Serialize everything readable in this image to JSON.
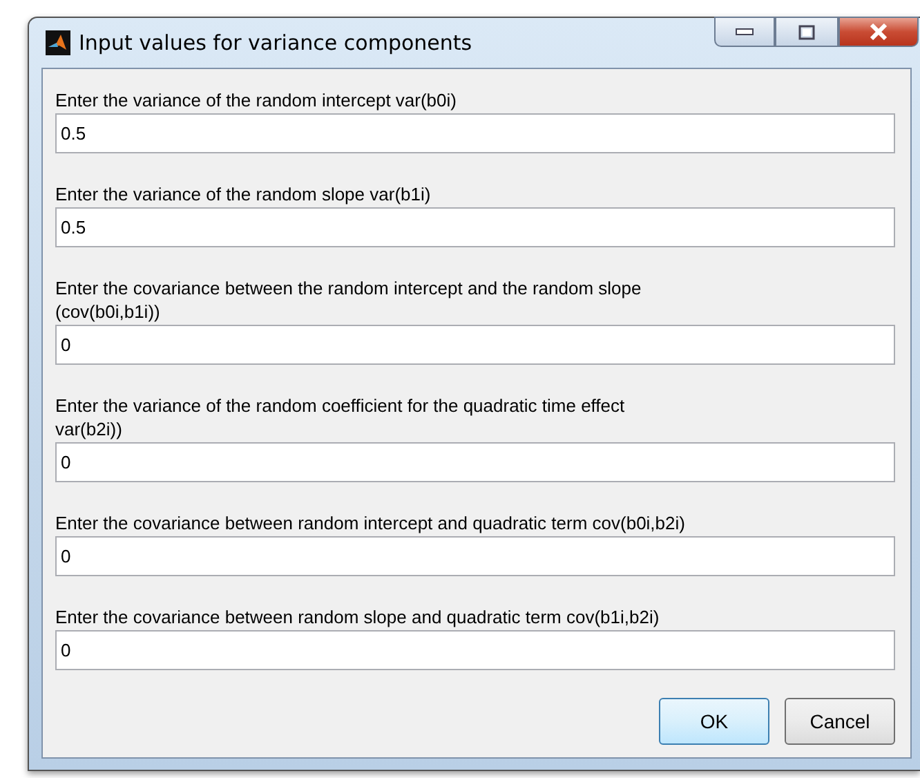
{
  "window": {
    "title": "Input values for variance components"
  },
  "fields": [
    {
      "label": "Enter the variance of the random intercept var(b0i)",
      "value": "0.5"
    },
    {
      "label": "Enter the variance of the random slope var(b1i)",
      "value": "0.5"
    },
    {
      "label": "Enter the covariance between the random intercept and the random slope\n(cov(b0i,b1i))",
      "value": "0"
    },
    {
      "label": "Enter the variance of the random coefficient for the quadratic time effect\nvar(b2i))",
      "value": "0"
    },
    {
      "label": "Enter the covariance between random intercept and quadratic term cov(b0i,b2i)",
      "value": "0"
    },
    {
      "label": "Enter the covariance between random slope and quadratic term cov(b1i,b2i)",
      "value": "0"
    }
  ],
  "buttons": [
    {
      "label": "OK",
      "default": true
    },
    {
      "label": "Cancel",
      "default": false
    }
  ]
}
